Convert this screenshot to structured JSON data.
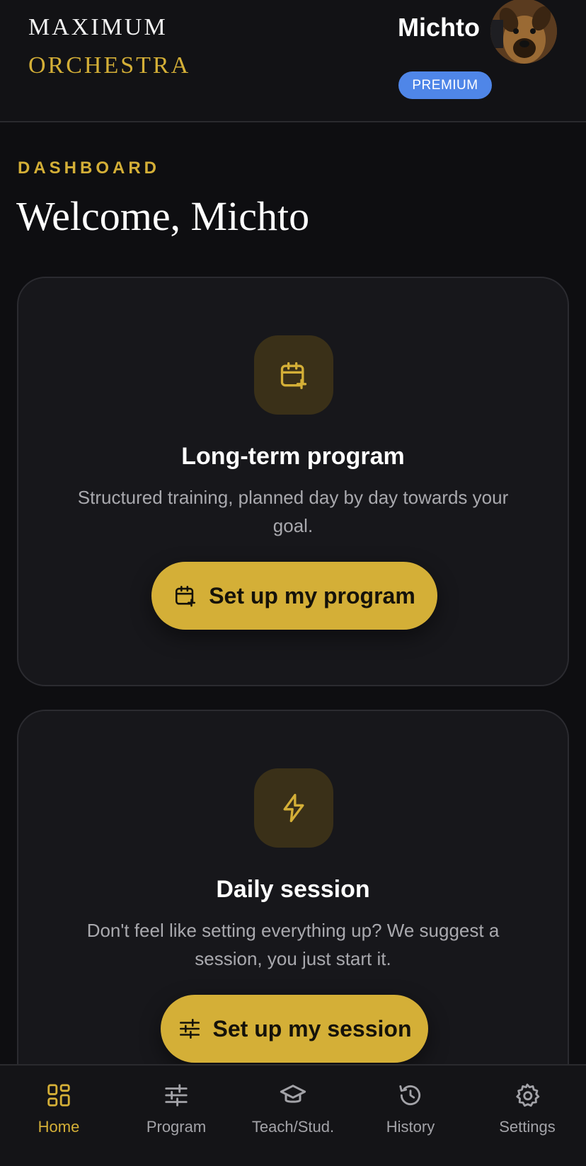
{
  "header": {
    "logo_line1": "MAXIMUM",
    "logo_line2": "ORCHESTRA",
    "user_name": "Michto",
    "badge": "PREMIUM",
    "avatar_icon": "dog-avatar"
  },
  "dashboard": {
    "section_label": "DASHBOARD",
    "welcome": "Welcome, Michto"
  },
  "cards": [
    {
      "icon": "calendar-plus-icon",
      "title": "Long-term program",
      "description": "Structured training, planned day by day towards your goal.",
      "button_label": "Set up my program",
      "button_icon": "calendar-plus-icon"
    },
    {
      "icon": "lightning-icon",
      "title": "Daily session",
      "description": "Don't feel like setting everything up? We suggest a session, you just start it.",
      "button_label": "Set up my session",
      "button_icon": "sliders-icon"
    }
  ],
  "nav": {
    "items": [
      {
        "label": "Home",
        "icon": "grid-icon",
        "active": true
      },
      {
        "label": "Program",
        "icon": "sliders-icon",
        "active": false
      },
      {
        "label": "Teach/Stud.",
        "icon": "graduation-cap-icon",
        "active": false
      },
      {
        "label": "History",
        "icon": "history-icon",
        "active": false
      },
      {
        "label": "Settings",
        "icon": "gear-icon",
        "active": false
      }
    ]
  },
  "colors": {
    "accent": "#d4af37",
    "badge": "#4f86e8",
    "background": "#0e0e11",
    "card": "#17171b"
  }
}
